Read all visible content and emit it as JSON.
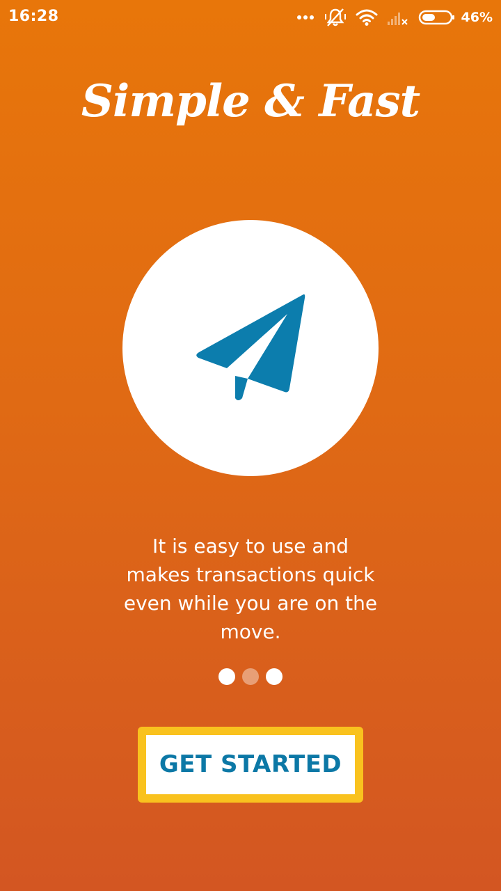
{
  "status_bar": {
    "time": "16:28",
    "battery_percent": "46%",
    "battery_level": 0.46,
    "icons": [
      "more-dots-icon",
      "vibrate-off-bell-icon",
      "wifi-icon",
      "cellular-signal-no-service-icon",
      "battery-icon"
    ]
  },
  "onboarding": {
    "title": "Simple & Fast",
    "hero_icon": "paper-plane-icon",
    "description": "It is easy to use and makes transactions quick even while you are on the move.",
    "page_indicator": {
      "total": 3,
      "current": 2
    },
    "cta_label": "GET STARTED"
  },
  "colors": {
    "background_top": "#E8760A",
    "background_bottom": "#D35622",
    "accent_blue": "#0C78A6",
    "button_highlight": "#F9C21E",
    "white": "#FFFFFF"
  }
}
